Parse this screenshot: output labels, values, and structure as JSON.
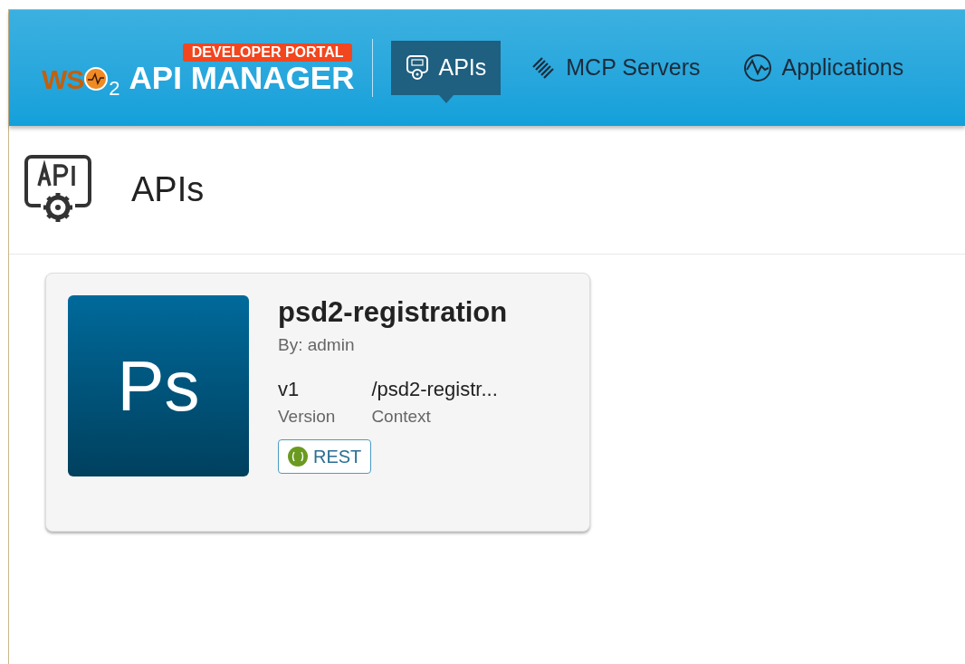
{
  "header": {
    "logo_prefix": "WS",
    "logo_suffix": "2",
    "product": "API MANAGER",
    "badge": "DEVELOPER PORTAL",
    "nav": [
      {
        "label": "APIs",
        "kind": "api",
        "selected": true
      },
      {
        "label": "MCP Servers",
        "kind": "mcp",
        "selected": false
      },
      {
        "label": "Applications",
        "kind": "apps",
        "selected": false
      }
    ]
  },
  "page": {
    "title": "APIs"
  },
  "cards": [
    {
      "thumbnail": "Ps",
      "name": "psd2-registration",
      "author": "By: admin",
      "version": "v1",
      "version_label": "Version",
      "context": "/psd2-registr...",
      "context_label": "Context",
      "type": "REST"
    }
  ]
}
